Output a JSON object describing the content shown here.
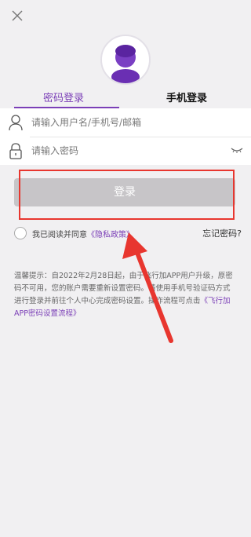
{
  "tabs": {
    "password_login": "密码登录",
    "phone_login": "手机登录"
  },
  "form": {
    "username_placeholder": "请输入用户名/手机号/邮箱",
    "password_placeholder": "请输入密码"
  },
  "login_button": "登录",
  "agreement": {
    "prefix": "我已阅读并同意",
    "privacy_link": "《隐私政策》",
    "forgot_password": "忘记密码?"
  },
  "notice": {
    "text": "温馨提示：自2022年2月28日起，由于飞行加APP用户升级，原密码不可用，您的账户需要重新设置密码。请使用手机号验证码方式进行登录并前往个人中心完成密码设置。操作流程可点击",
    "link": "《飞行加APP密码设置流程》"
  },
  "colors": {
    "accent": "#7b3fb7",
    "annotation": "#e8362f",
    "button_disabled": "#c7c5c8"
  },
  "icons": [
    "close-icon",
    "avatar-icon",
    "user-icon",
    "lock-icon",
    "eye-closed-icon"
  ]
}
